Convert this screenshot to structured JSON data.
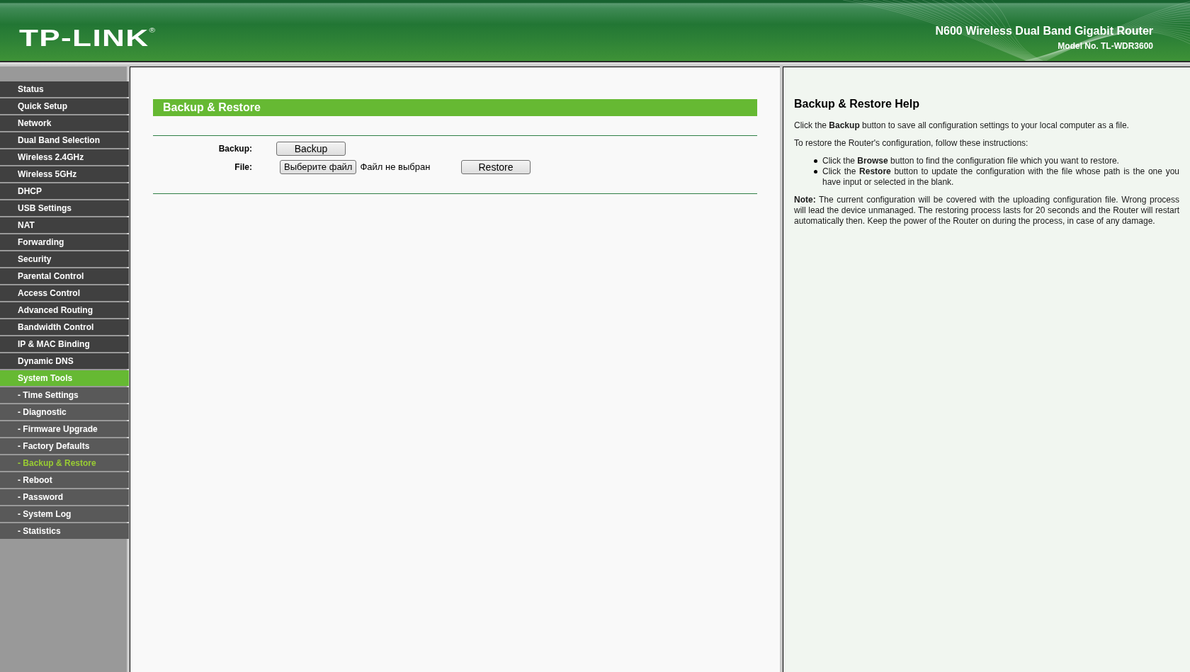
{
  "header": {
    "logo": "TP-LINK",
    "logo_mark": "®",
    "product": "N600 Wireless Dual Band Gigabit Router",
    "model": "Model No. TL-WDR3600"
  },
  "menu": [
    {
      "label": "Status",
      "selected": false
    },
    {
      "label": "Quick Setup",
      "selected": false
    },
    {
      "label": "Network",
      "selected": false
    },
    {
      "label": "Dual Band Selection",
      "selected": false
    },
    {
      "label": "Wireless 2.4GHz",
      "selected": false
    },
    {
      "label": "Wireless 5GHz",
      "selected": false
    },
    {
      "label": "DHCP",
      "selected": false
    },
    {
      "label": "USB Settings",
      "selected": false
    },
    {
      "label": "NAT",
      "selected": false
    },
    {
      "label": "Forwarding",
      "selected": false
    },
    {
      "label": "Security",
      "selected": false
    },
    {
      "label": "Parental Control",
      "selected": false
    },
    {
      "label": "Access Control",
      "selected": false
    },
    {
      "label": "Advanced Routing",
      "selected": false
    },
    {
      "label": "Bandwidth Control",
      "selected": false
    },
    {
      "label": "IP & MAC Binding",
      "selected": false
    },
    {
      "label": "Dynamic DNS",
      "selected": false
    },
    {
      "label": "System Tools",
      "selected": true,
      "children": [
        {
          "label": "- Time Settings",
          "selected": false
        },
        {
          "label": "- Diagnostic",
          "selected": false
        },
        {
          "label": "- Firmware Upgrade",
          "selected": false
        },
        {
          "label": "- Factory Defaults",
          "selected": false
        },
        {
          "label": "- Backup & Restore",
          "selected": true
        },
        {
          "label": "- Reboot",
          "selected": false
        },
        {
          "label": "- Password",
          "selected": false
        },
        {
          "label": "- System Log",
          "selected": false
        },
        {
          "label": "- Statistics",
          "selected": false
        }
      ]
    }
  ],
  "section": {
    "title": "Backup & Restore",
    "rows": [
      {
        "kind": "button",
        "label": "Backup:",
        "button": "Backup"
      },
      {
        "kind": "file",
        "label": "File:",
        "choose_button": "Выберите файл",
        "file_status": "Файл не выбран",
        "button": "Restore"
      }
    ]
  },
  "help": {
    "title": "Backup & Restore Help",
    "blocks": [
      {
        "kind": "paragraph",
        "text": "Click the **Backup** button to save all configuration settings to your local computer as a file."
      },
      {
        "kind": "paragraph",
        "text": "To restore the Router's configuration, follow these instructions:"
      },
      {
        "kind": "list",
        "items": [
          "Click the **Browse** button to find the configuration file which you want to restore.",
          "Click the **Restore** button to update the configuration with the file whose path is the one you have input or selected in the blank."
        ]
      },
      {
        "kind": "paragraph",
        "text": "**Note:** The current configuration will be covered with the uploading configuration file. Wrong process will lead the device unmanaged. The restoring process lasts for 20 seconds and the Router will restart automatically then. Keep the power of the Router on during the process, in case of any damage."
      }
    ]
  }
}
